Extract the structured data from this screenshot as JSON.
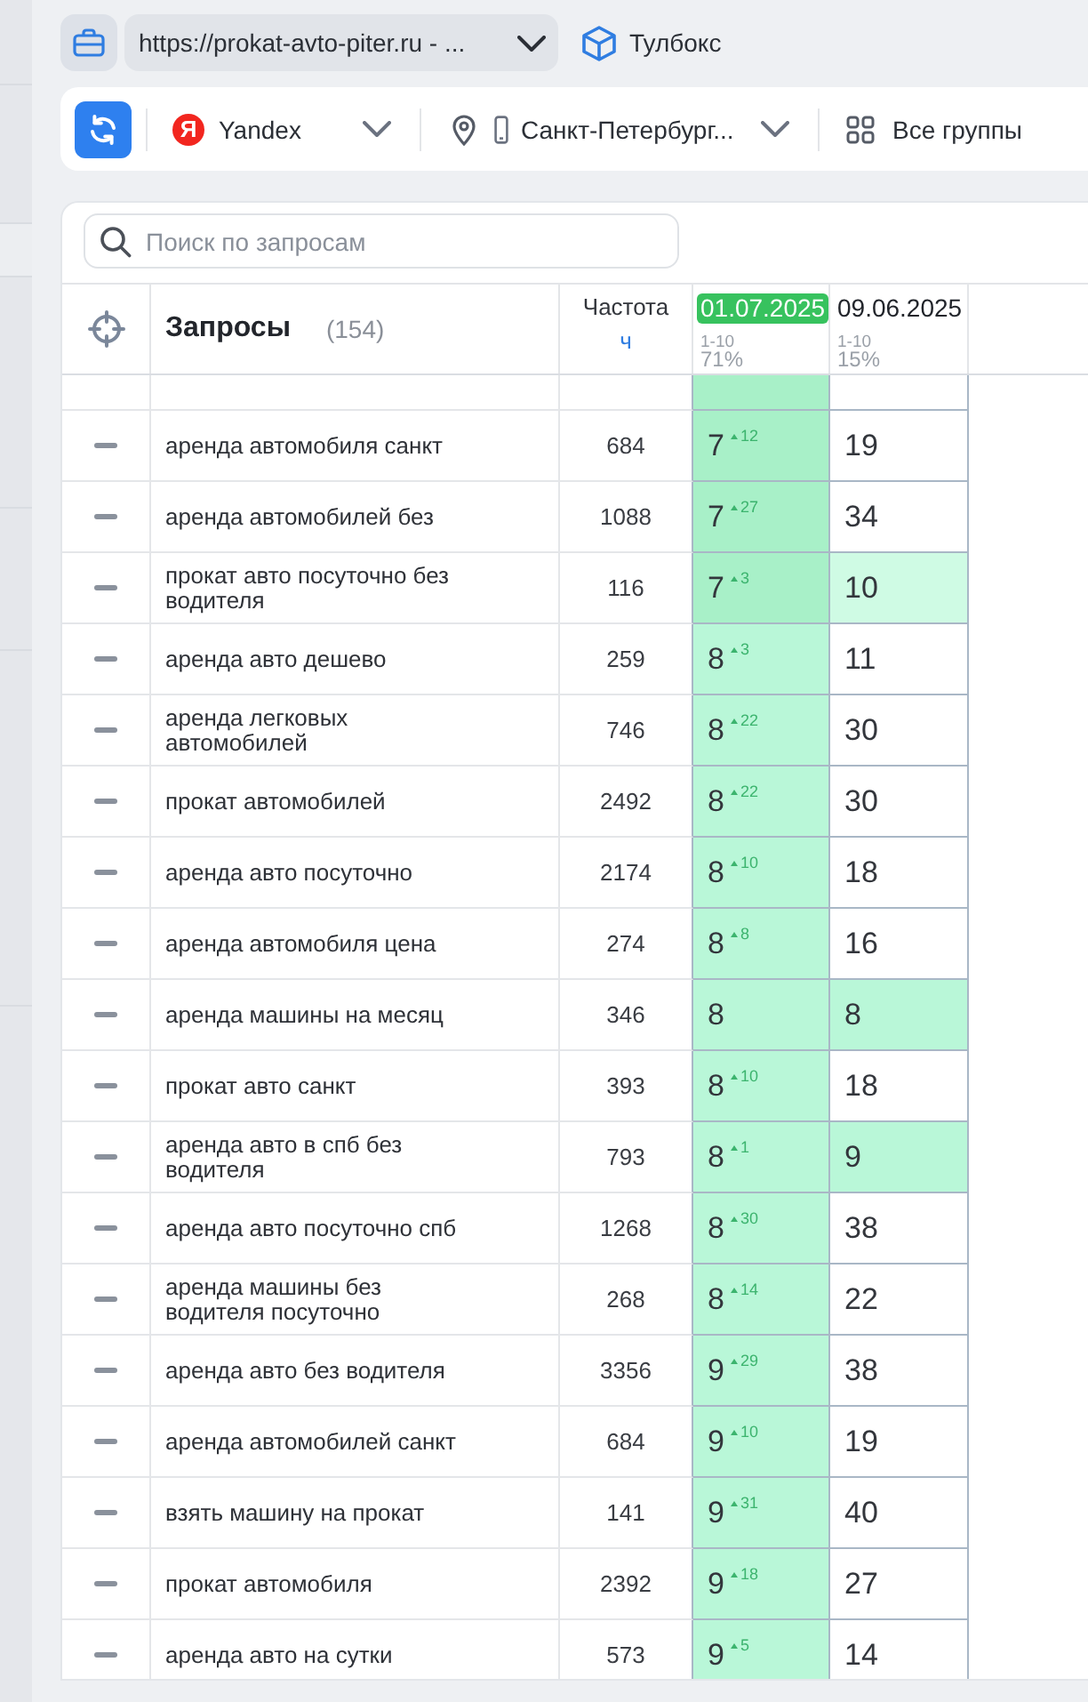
{
  "toolbar": {
    "project_url": "https://prokat-avto-piter.ru - ...",
    "toolbox": "Тулбокс"
  },
  "filters": {
    "engine": {
      "logo": "Я",
      "label": "Yandex"
    },
    "region": "Санкт-Петербург...",
    "groups": "Все группы"
  },
  "search": {
    "placeholder": "Поиск по запросам"
  },
  "table": {
    "query_header": "Запросы",
    "query_count": "(154)",
    "frequency_header": "Частота",
    "frequency_type": "ч",
    "dates": [
      {
        "date": "01.07.2025",
        "selected": true,
        "range": "1-10",
        "share": "71%"
      },
      {
        "date": "09.06.2025",
        "selected": false,
        "range": "1-10",
        "share": "15%"
      }
    ],
    "rows": [
      {
        "positions": [
          {
            "color": "#a8f0c8"
          }
        ]
      },
      {
        "query": "аренда автомобиля санкт",
        "frequency": "684",
        "positions": [
          {
            "value": "7",
            "change": "12",
            "color": "#a8f0c8"
          },
          {
            "value": "19"
          }
        ]
      },
      {
        "query": "аренда автомобилей без",
        "frequency": "1088",
        "positions": [
          {
            "value": "7",
            "change": "27",
            "color": "#a8f0c8"
          },
          {
            "value": "34"
          }
        ]
      },
      {
        "query": "прокат авто посуточно без водителя",
        "frequency": "116",
        "positions": [
          {
            "value": "7",
            "change": "3",
            "color": "#a8f0c8"
          },
          {
            "value": "10",
            "color": "#cffbe4"
          }
        ]
      },
      {
        "query": "аренда авто дешево",
        "frequency": "259",
        "positions": [
          {
            "value": "8",
            "change": "3",
            "color": "#b9f7d8"
          },
          {
            "value": "11"
          }
        ]
      },
      {
        "query": "аренда легковых автомобилей",
        "frequency": "746",
        "positions": [
          {
            "value": "8",
            "change": "22",
            "color": "#b9f7d8"
          },
          {
            "value": "30"
          }
        ]
      },
      {
        "query": "прокат автомобилей",
        "frequency": "2492",
        "positions": [
          {
            "value": "8",
            "change": "22",
            "color": "#b9f7d8"
          },
          {
            "value": "30"
          }
        ]
      },
      {
        "query": "аренда авто посуточно",
        "frequency": "2174",
        "positions": [
          {
            "value": "8",
            "change": "10",
            "color": "#b9f7d8"
          },
          {
            "value": "18"
          }
        ]
      },
      {
        "query": "аренда автомобиля цена",
        "frequency": "274",
        "positions": [
          {
            "value": "8",
            "change": "8",
            "color": "#b9f7d8"
          },
          {
            "value": "16"
          }
        ]
      },
      {
        "query": "аренда машины на месяц",
        "frequency": "346",
        "positions": [
          {
            "value": "8",
            "color": "#b9f7d8"
          },
          {
            "value": "8",
            "color": "#b9f7d8"
          }
        ]
      },
      {
        "query": "прокат авто санкт",
        "frequency": "393",
        "positions": [
          {
            "value": "8",
            "change": "10",
            "color": "#b9f7d8"
          },
          {
            "value": "18"
          }
        ]
      },
      {
        "query": "аренда авто в спб без водителя",
        "frequency": "793",
        "positions": [
          {
            "value": "8",
            "change": "1",
            "color": "#b9f7d8"
          },
          {
            "value": "9",
            "color": "#b9f7d8"
          }
        ]
      },
      {
        "query": "аренда авто посуточно спб",
        "frequency": "1268",
        "positions": [
          {
            "value": "8",
            "change": "30",
            "color": "#b9f7d8"
          },
          {
            "value": "38"
          }
        ]
      },
      {
        "query": "аренда машины без водителя посуточно",
        "frequency": "268",
        "positions": [
          {
            "value": "8",
            "change": "14",
            "color": "#b9f7d8"
          },
          {
            "value": "22"
          }
        ]
      },
      {
        "query": "аренда авто без водителя",
        "frequency": "3356",
        "positions": [
          {
            "value": "9",
            "change": "29",
            "color": "#b9f7d8"
          },
          {
            "value": "38"
          }
        ]
      },
      {
        "query": "аренда автомобилей санкт",
        "frequency": "684",
        "positions": [
          {
            "value": "9",
            "change": "10",
            "color": "#b9f7d8"
          },
          {
            "value": "19"
          }
        ]
      },
      {
        "query": "взять машину на прокат",
        "frequency": "141",
        "positions": [
          {
            "value": "9",
            "change": "31",
            "color": "#b9f7d8"
          },
          {
            "value": "40"
          }
        ]
      },
      {
        "query": "прокат автомобиля",
        "frequency": "2392",
        "positions": [
          {
            "value": "9",
            "change": "18",
            "color": "#b9f7d8"
          },
          {
            "value": "27"
          }
        ]
      },
      {
        "query": "аренда авто на сутки",
        "frequency": "573",
        "positions": [
          {
            "value": "9",
            "change": "5",
            "color": "#b9f7d8"
          },
          {
            "value": "14"
          }
        ]
      }
    ]
  }
}
